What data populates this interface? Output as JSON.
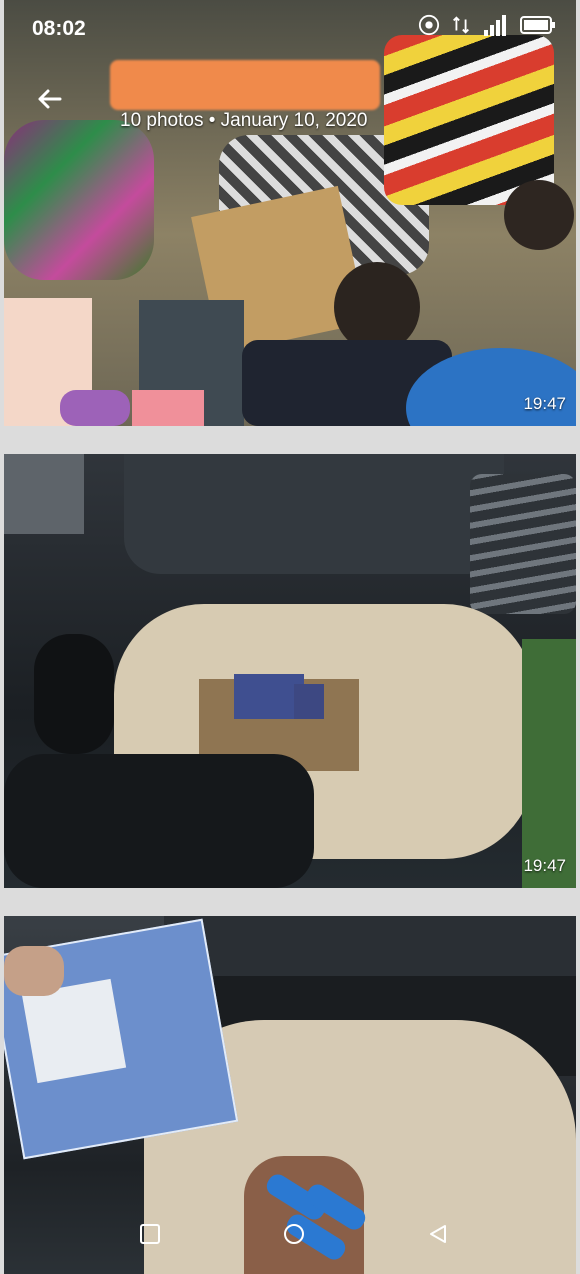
{
  "status_bar": {
    "time": "08:02"
  },
  "header": {
    "subtitle": "10 photos • January 10, 2020"
  },
  "photos": [
    {
      "time": "19:47"
    },
    {
      "time": "19:47"
    },
    {
      "time": ""
    }
  ],
  "icons": [
    "arrow-left-icon",
    "hotspot-icon",
    "data-arrows-icon",
    "signal-icon",
    "battery-icon",
    "square-nav-icon",
    "circle-nav-icon",
    "triangle-nav-icon"
  ],
  "colors": {
    "background": "#dcdcdc",
    "redaction": "#f08a4b"
  }
}
